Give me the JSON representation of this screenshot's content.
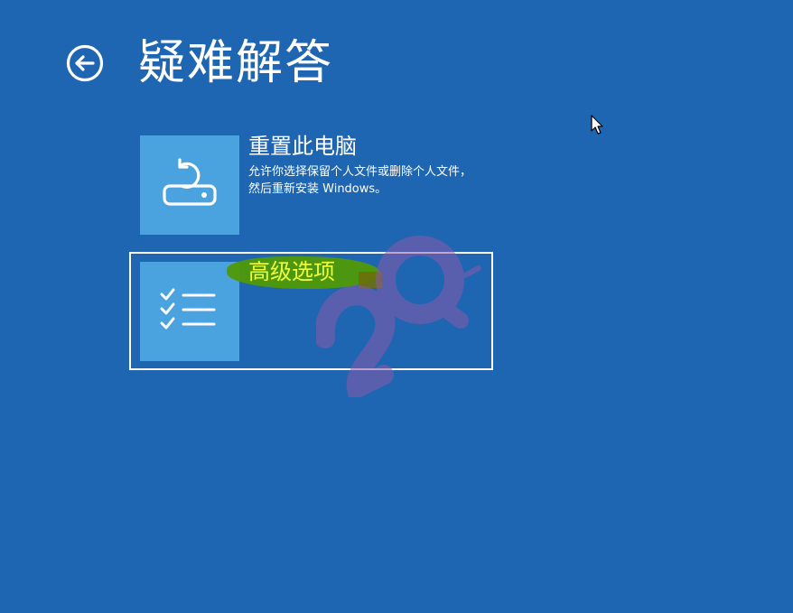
{
  "header": {
    "back_icon": "back-arrow-circle-icon",
    "title": "疑难解答"
  },
  "options": [
    {
      "title": "重置此电脑",
      "description": "允许你选择保留个人文件或删除个人文件，然后重新安装 Windows。",
      "icon": "reset-pc-icon",
      "selected": false
    },
    {
      "title": "高级选项",
      "icon": "checklist-icon",
      "selected": true
    }
  ],
  "colors": {
    "background": "#1f66b2",
    "tile": "#4aa3df",
    "highlight": "#4f9a06",
    "highlight_text": "#f0ff3c"
  }
}
